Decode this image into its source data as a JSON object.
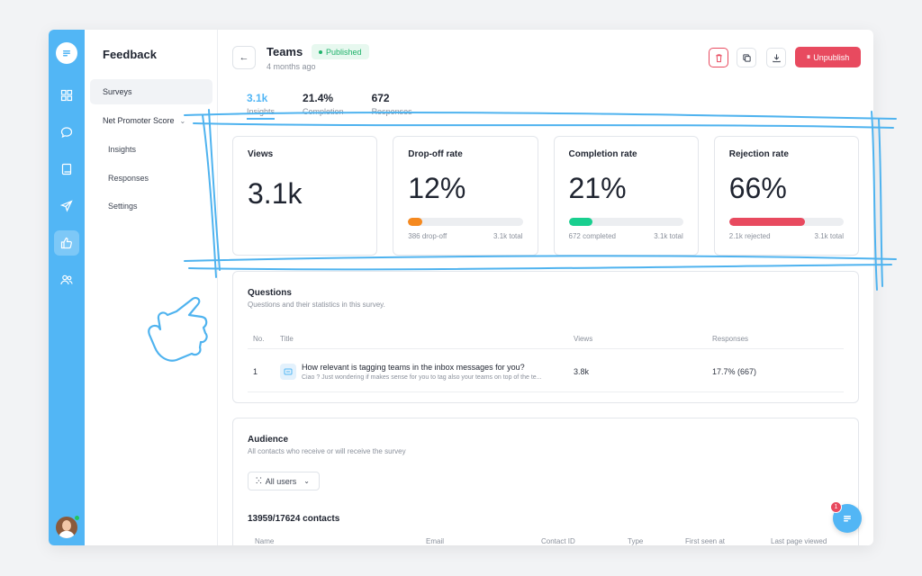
{
  "sidebar": {
    "title": "Feedback",
    "items": [
      {
        "label": "Surveys"
      },
      {
        "label": "Net Promoter Score"
      },
      {
        "label": "Insights"
      },
      {
        "label": "Responses"
      },
      {
        "label": "Settings"
      }
    ]
  },
  "header": {
    "title": "Teams",
    "status": "Published",
    "subtitle": "4 months ago",
    "unpublish_label": "Unpublish",
    "back_icon": "arrow-left-icon"
  },
  "tabs": [
    {
      "value": "3.1k",
      "label": "Insights"
    },
    {
      "value": "21.4%",
      "label": "Completion"
    },
    {
      "value": "672",
      "label": "Responses"
    }
  ],
  "stats": {
    "views": {
      "label": "Views",
      "value": "3.1k"
    },
    "dropoff": {
      "label": "Drop-off rate",
      "value": "12%",
      "left": "386 drop-off",
      "right": "3.1k total",
      "fraction": 0.12,
      "color": "#f5891f"
    },
    "completion": {
      "label": "Completion rate",
      "value": "21%",
      "left": "672 completed",
      "right": "3.1k total",
      "fraction": 0.21,
      "color": "#19cf8f"
    },
    "rejection": {
      "label": "Rejection rate",
      "value": "66%",
      "left": "2.1k rejected",
      "right": "3.1k total",
      "fraction": 0.66,
      "color": "#e84a5f"
    }
  },
  "questions": {
    "title": "Questions",
    "description": "Questions and their statistics in this survey.",
    "columns": {
      "no": "No.",
      "title": "Title",
      "views": "Views",
      "responses": "Responses"
    },
    "rows": [
      {
        "no": "1",
        "title": "How relevant is tagging teams in the inbox messages for you?",
        "desc": "Ciao ? Just wondering if makes sense for you to tag also your teams on top of the te...",
        "views": "3.8k",
        "responses": "17.7% (667)"
      }
    ]
  },
  "audience": {
    "title": "Audience",
    "description": "All contacts who receive or will receive the survey",
    "filter": "All users",
    "contacts": "13959/17624 contacts",
    "columns": {
      "name": "Name",
      "email": "Email",
      "contact_id": "Contact ID",
      "type": "Type",
      "first_seen": "First seen at",
      "last_page": "Last page viewed"
    }
  },
  "chat": {
    "badge": "1"
  },
  "colors": {
    "accent": "#52b6f5",
    "danger": "#e84a5f",
    "success": "#20b26b"
  }
}
